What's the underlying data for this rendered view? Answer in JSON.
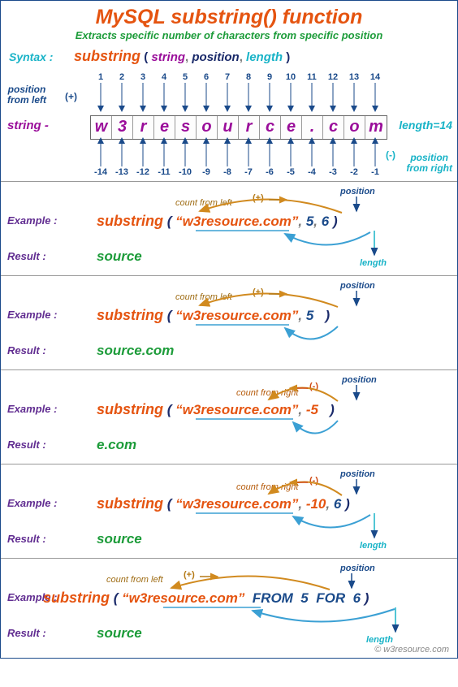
{
  "title": "MySQL substring() function",
  "subtitle": "Extracts specific number of characters from specific position",
  "syntax": {
    "label": "Syntax :",
    "fn": "substring",
    "paren_open": "(",
    "paren_close": ")",
    "arg_string": "string",
    "arg_position": "position",
    "arg_length": "length",
    "comma": ","
  },
  "diagram": {
    "pos_from_left": "position\nfrom left",
    "pos_from_right": "position\nfrom right",
    "plus": "(+)",
    "minus": "(-)",
    "string_label": "string -",
    "length_label": "length=14",
    "top_nums": [
      "1",
      "2",
      "3",
      "4",
      "5",
      "6",
      "7",
      "8",
      "9",
      "10",
      "11",
      "12",
      "13",
      "14"
    ],
    "chars": [
      "w",
      "3",
      "r",
      "e",
      "s",
      "o",
      "u",
      "r",
      "c",
      "e",
      ".",
      "c",
      "o",
      "m"
    ],
    "bot_nums": [
      "-14",
      "-13",
      "-12",
      "-11",
      "-10",
      "-9",
      "-8",
      "-7",
      "-6",
      "-5",
      "-4",
      "-3",
      "-2",
      "-1"
    ]
  },
  "ex_label": "Example :",
  "res_label": "Result :",
  "pos_tag": "position",
  "len_tag": "length",
  "hint_cfl": "count from left",
  "hint_cfr": "count from right",
  "sign_plus": "(+)",
  "sign_minus": "(-)",
  "from_kw": "FROM",
  "for_kw": "FOR",
  "examples": [
    {
      "str": "“w3resource.com”",
      "pos": "5",
      "len": "6",
      "neg": false,
      "result": "source",
      "hint": "left"
    },
    {
      "str": "“w3resource.com”",
      "pos": "5",
      "len": "",
      "neg": false,
      "result": "source.com",
      "hint": "left"
    },
    {
      "str": "“w3resource.com”",
      "pos": "-5",
      "len": "",
      "neg": true,
      "result": "e.com",
      "hint": "right"
    },
    {
      "str": "“w3resource.com”",
      "pos": "-10",
      "len": "6",
      "neg": true,
      "result": "source",
      "hint": "right"
    },
    {
      "str": "“w3resource.com”",
      "pos": "5",
      "len": "6",
      "neg": false,
      "result": "source",
      "hint": "left",
      "from_for": true
    }
  ],
  "footer": "© w3resource.com"
}
